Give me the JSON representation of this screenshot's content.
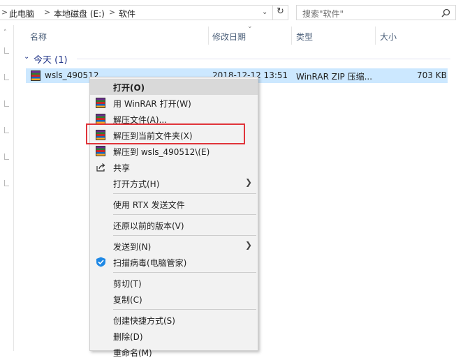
{
  "address": {
    "crumbs": [
      "此电脑",
      "本地磁盘 (E:)",
      "软件"
    ],
    "separator": ">",
    "dropdown_icon": "chevron-down-icon",
    "refresh_icon": "refresh-icon"
  },
  "search": {
    "placeholder": "搜索\"软件\"",
    "icon": "search-icon"
  },
  "columns": {
    "name": "名称",
    "date": "修改日期",
    "type": "类型",
    "size": "大小"
  },
  "group": {
    "label": "今天 (1)"
  },
  "file": {
    "name": "wsls_490512.zip",
    "name_visible": "wsls_490512",
    "date": "2018-12-12 13:51",
    "type": "WinRAR ZIP 压缩...",
    "size": "703 KB"
  },
  "menu": {
    "items": [
      {
        "label": "打开(O)",
        "bold": true,
        "icon": ""
      },
      {
        "label": "用 WinRAR 打开(W)",
        "icon": "winrar-icon"
      },
      {
        "label": "解压文件(A)...",
        "icon": "winrar-icon"
      },
      {
        "label": "解压到当前文件夹(X)",
        "icon": "winrar-icon",
        "highlighted_box": true
      },
      {
        "label": "解压到 wsls_490512\\(E)",
        "icon": "winrar-icon"
      },
      {
        "label": "共享",
        "icon": "share-icon"
      },
      {
        "label": "打开方式(H)",
        "submenu": true
      },
      {
        "label": "使用 RTX 发送文件"
      },
      {
        "label": "还原以前的版本(V)"
      },
      {
        "label": "发送到(N)",
        "submenu": true
      },
      {
        "label": "扫描病毒(电脑管家)",
        "icon": "shield-icon"
      },
      {
        "label": "剪切(T)"
      },
      {
        "label": "复制(C)"
      },
      {
        "label": "创建快捷方式(S)"
      },
      {
        "label": "删除(D)"
      },
      {
        "label": "重命名(M)"
      }
    ]
  },
  "colors": {
    "accent": "#1e3287",
    "selection": "#cce8ff",
    "highlight_border": "#e0343a"
  }
}
